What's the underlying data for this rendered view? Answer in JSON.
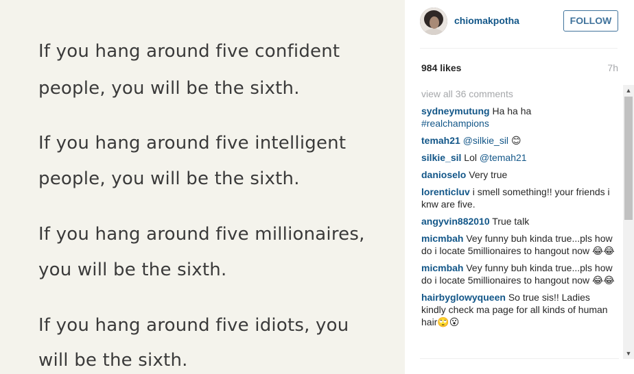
{
  "post_image": {
    "lines": [
      "If you hang around five confident",
      "people, you will be the sixth.",
      "If you hang around five intelligent",
      "people, you will be the sixth.",
      "If you hang around five millionaires,",
      "you will be the sixth.",
      "If you hang around five idiots, you",
      "will be the sixth."
    ]
  },
  "header": {
    "username": "chiomakpotha",
    "follow_label": "FOLLOW"
  },
  "meta": {
    "likes": "984 likes",
    "time": "7h"
  },
  "comments": {
    "view_all": "view all 36 comments",
    "items": [
      {
        "user": "sydneymutung",
        "text": "Ha ha ha",
        "tag": "#realchampions"
      },
      {
        "user": "temah21",
        "tag": "@silkie_sil",
        "text": "😊"
      },
      {
        "user": "silkie_sil",
        "text": "Lol",
        "tag": "@temah21"
      },
      {
        "user": "danioselo",
        "text": "Very true"
      },
      {
        "user": "lorenticluv",
        "text": "i smell something!! your friends i knw are five."
      },
      {
        "user": "angyvin882010",
        "text": "True talk"
      },
      {
        "user": "micmbah",
        "text": "Vey funny buh kinda true...pls how do i locate 5millionaires to hangout now 😂😂"
      },
      {
        "user": "micmbah",
        "text": "Vey funny buh kinda true...pls how do i locate 5millionaires to hangout now 😂😂"
      },
      {
        "user": "hairbyglowyqueen",
        "text": "So true sis!! Ladies kindly check ma page for all kinds of human hair🙄😮"
      }
    ]
  },
  "scrollbar": {
    "up_icon": "▲",
    "down_icon": "▼"
  }
}
